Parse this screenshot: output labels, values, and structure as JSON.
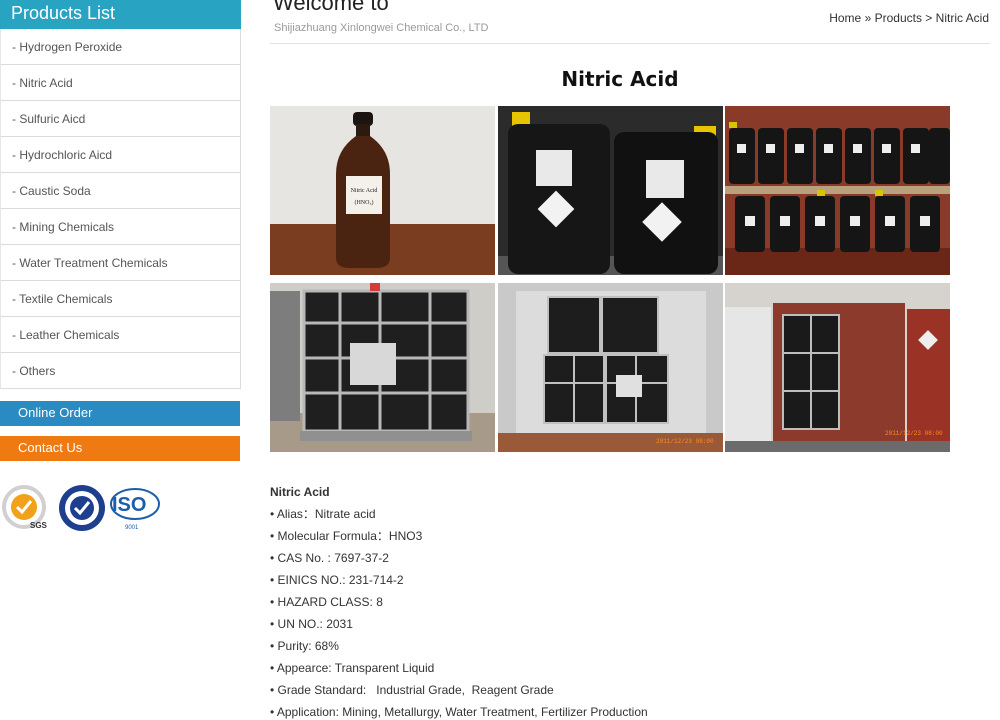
{
  "sidebar": {
    "title": "Products List",
    "items": [
      "- Hydrogen Peroxide",
      "- Nitric Acid",
      "- Sulfuric Aicd",
      "- Hydrochloric Aicd",
      "- Caustic Soda",
      "- Mining Chemicals",
      "- Water Treatment Chemicals",
      "- Textile Chemicals",
      "- Leather Chemicals",
      "- Others"
    ],
    "online_order": "Online Order",
    "contact_us": "Contact Us",
    "cert_labels": {
      "sgs": "SGS",
      "iso": "ISO",
      "iso_sub": "9001",
      "iso9001": "ISO 9001"
    }
  },
  "header": {
    "welcome": "Welcome to",
    "company": "Shijiazhuang Xinlongwei Chemical Co., LTD",
    "breadcrumb": [
      "Home",
      "»",
      "Products",
      ">",
      "Nitric Acid"
    ]
  },
  "product": {
    "title": "Nitric Acid",
    "bottle_label": [
      "Nitric Acid",
      "(HNO₃)"
    ],
    "photo_stamps": {
      "containers_inside": "2011/12/23 08:00",
      "container_door": "2011/12/23 08:00"
    },
    "spec_title": "Nitric Acid",
    "specs": [
      "• Alias：Nitrate acid",
      "• Molecular Formula：HNO3",
      "• CAS No. : 7697-37-2",
      "• EINICS NO.: 231-714-2",
      "• HAZARD CLASS: 8",
      "• UN NO.: 2031",
      "• Purity: 68%",
      "• Appearce: Transparent Liquid",
      "• Grade Standard:   Industrial Grade,  Reagent Grade",
      "• Application: Mining, Metallurgy, Water Treatment, Fertilizer Production"
    ]
  },
  "colors": {
    "sidebar_title": "#29a3c2",
    "online_order": "#2a8ac2",
    "contact_us": "#f07a12"
  }
}
